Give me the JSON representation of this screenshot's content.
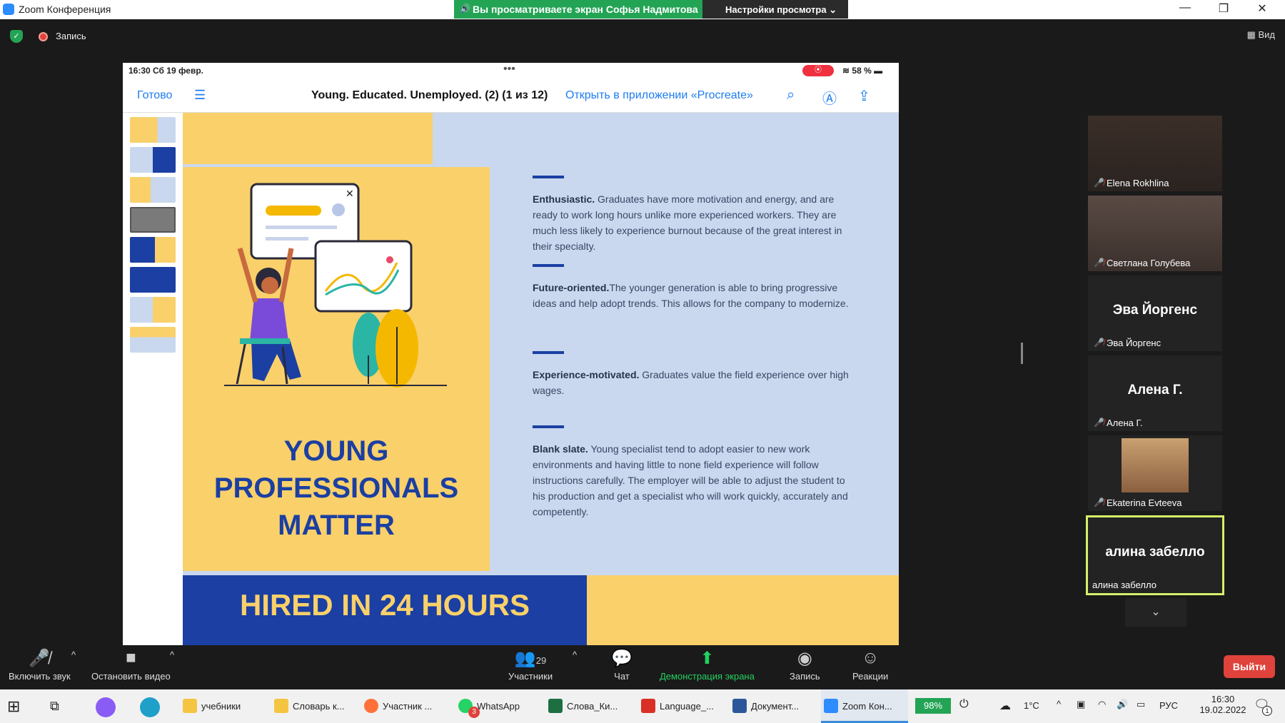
{
  "window": {
    "title": "Zoom Конференция"
  },
  "share_banner": {
    "text": "Вы просматриваете экран Софья Надмитова",
    "view_settings": "Настройки просмотра ⌄"
  },
  "topbar": {
    "record_label": "Запись",
    "view_label": "Вид"
  },
  "ipad": {
    "time": "16:30  Сб 19 февр.",
    "battery": "58 %",
    "done": "Готово",
    "doc_title": "Young. Educated. Unemployed. (2) (1 из 12)",
    "open_in": "Открыть в приложении «Procreate»"
  },
  "slide": {
    "title": "YOUNG PROFESSIONALS MATTER",
    "sections": [
      {
        "heading": "Enthusiastic.",
        "body": " Graduates have more motivation and energy, and are ready to work long hours unlike more experienced workers. They are much less likely to experience burnout because of the great interest in their specialty."
      },
      {
        "heading": "Future-oriented.",
        "body": "The younger generation is able to bring progressive ideas and help adopt trends. This allows for the company to modernize."
      },
      {
        "heading": "Experience-motivated.",
        "body": " Graduates value the field experience over high wages."
      },
      {
        "heading": "Blank slate.",
        "body": " Young specialist tend to adopt easier to new work environments and having little to none field experience will follow instructions carefully. The employer will be able to adjust the student to his production and get a specialist who will work quickly, accurately and competently."
      }
    ],
    "bottom_banner": "HIRED IN 24 HOURS"
  },
  "participants": [
    {
      "name": "Elena Rokhlina",
      "muted": true,
      "video": true
    },
    {
      "name": "Светлана Голубева",
      "muted": true,
      "video": true
    },
    {
      "name": "Эва Йоргенс",
      "muted": true,
      "video": false
    },
    {
      "name": "Алена Г.",
      "muted": true,
      "video": false
    },
    {
      "name": "Ekaterina Evteeva",
      "muted": true,
      "video": true
    },
    {
      "name": "алина забелло",
      "muted": false,
      "video": false,
      "active": true
    }
  ],
  "toolbar": {
    "unmute": "Включить звук",
    "stop_video": "Остановить видео",
    "participants_count": "29",
    "participants": "Участники",
    "chat": "Чат",
    "share": "Демонстрация экрана",
    "record": "Запись",
    "reactions": "Реакции",
    "leave": "Выйти"
  },
  "taskbar": {
    "items": [
      "учебники",
      "Словарь к...",
      "Участник ...",
      "WhatsApp",
      "Слова_Ки...",
      "Language_...",
      "Документ...",
      "Zoom Кон..."
    ],
    "whatsapp_badge": "3",
    "battery": "98%",
    "temp": "1°C",
    "lang": "РУС",
    "time": "16:30",
    "date": "19.02.2022",
    "notif_badge": "1"
  }
}
